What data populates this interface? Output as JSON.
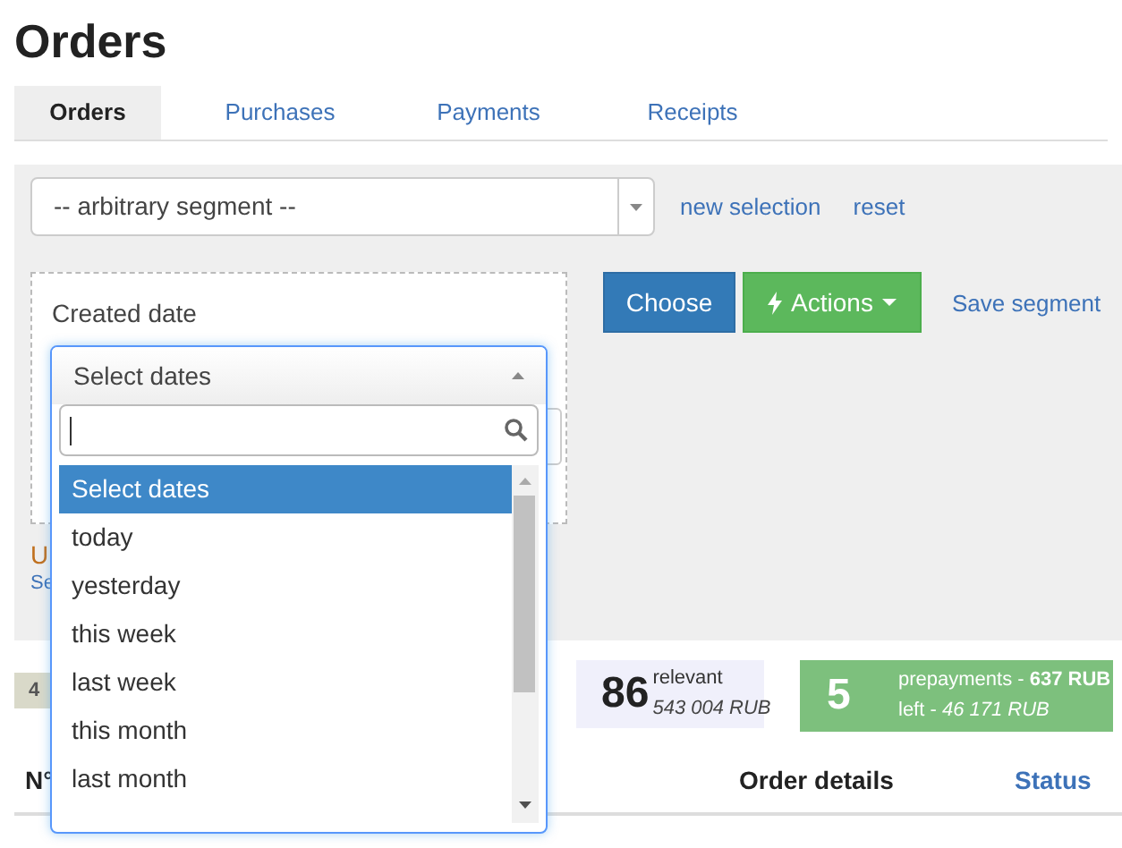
{
  "page_title": "Orders",
  "tabs": [
    {
      "label": "Orders",
      "selected": true
    },
    {
      "label": "Purchases",
      "selected": false
    },
    {
      "label": "Payments",
      "selected": false
    },
    {
      "label": "Receipts",
      "selected": false
    }
  ],
  "filter_panel": {
    "segment_select": {
      "value": "-- arbitrary segment --"
    },
    "links": [
      "new selection",
      "reset"
    ],
    "filter": {
      "label": "Created date"
    },
    "buttons": [
      {
        "kind": "primary",
        "label": "Choose"
      },
      {
        "kind": "actions",
        "label": "Actions"
      }
    ],
    "save_link": "Save segment",
    "hidden_fragments": [
      {
        "kind": "warning",
        "text": "U"
      },
      {
        "kind": "link",
        "text": "Se"
      }
    ]
  },
  "stats": {
    "count_badge": "4",
    "relevant": {
      "count": "86",
      "label": "relevant",
      "amount": "543 004 RUB"
    },
    "prepayments": {
      "count": "5",
      "line1": "prepayments - **637 RUB**",
      "line2": "left - *46 171 RUB*"
    }
  },
  "table": {
    "columns": [
      {
        "label": "N°",
        "link": false
      },
      {
        "label": "Order details",
        "link": false
      },
      {
        "label": "Status",
        "link": true
      }
    ]
  },
  "dropdown": {
    "value": "Select dates",
    "options": [
      {
        "label": "Select dates",
        "selected": true
      },
      {
        "label": "today",
        "selected": false
      },
      {
        "label": "yesterday",
        "selected": false
      },
      {
        "label": "this week",
        "selected": false
      },
      {
        "label": "last week",
        "selected": false
      },
      {
        "label": "this month",
        "selected": false
      },
      {
        "label": "last month",
        "selected": false
      }
    ]
  }
}
